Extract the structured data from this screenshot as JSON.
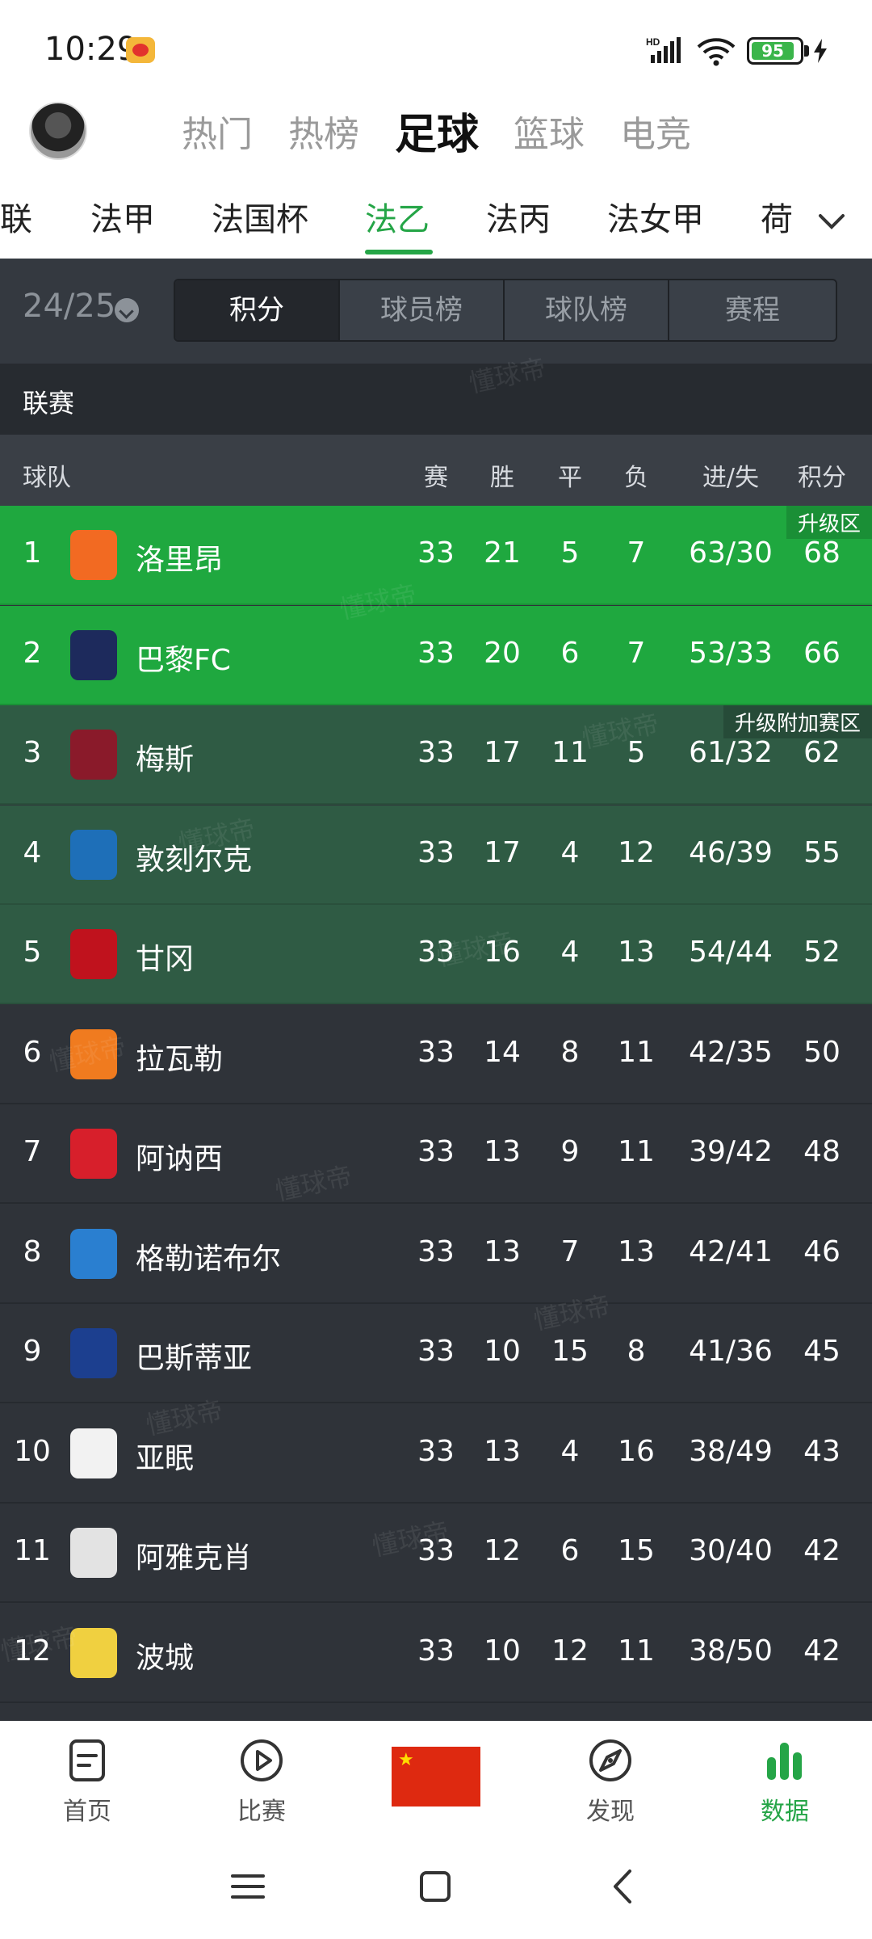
{
  "status_bar": {
    "time": "10:29",
    "battery": "95"
  },
  "top_tabs": [
    "热门",
    "热榜",
    "足球",
    "篮球",
    "电竞"
  ],
  "top_tab_active": 2,
  "league_tabs": [
    "联",
    "法甲",
    "法国杯",
    "法乙",
    "法丙",
    "法女甲",
    "荷"
  ],
  "league_tab_active": 3,
  "season": {
    "label": "24/25"
  },
  "segment_tabs": [
    "积分",
    "球员榜",
    "球队榜",
    "赛程"
  ],
  "segment_active": 0,
  "section_title": "联赛",
  "columns": {
    "team": "球队",
    "played": "赛",
    "won": "胜",
    "drawn": "平",
    "lost": "负",
    "goals": "进/失",
    "points": "积分"
  },
  "zones": {
    "promotion": "升级区",
    "playoff": "升级附加赛区"
  },
  "standings": [
    {
      "rank": "1",
      "team": "洛里昂",
      "played": "33",
      "won": "21",
      "drawn": "5",
      "lost": "7",
      "goals": "63/30",
      "points": "68",
      "zone": "promotion",
      "logo_color": "#f26a22"
    },
    {
      "rank": "2",
      "team": "巴黎FC",
      "played": "33",
      "won": "20",
      "drawn": "6",
      "lost": "7",
      "goals": "53/33",
      "points": "66",
      "zone": "promotion",
      "logo_color": "#1d2a5c"
    },
    {
      "rank": "3",
      "team": "梅斯",
      "played": "33",
      "won": "17",
      "drawn": "11",
      "lost": "5",
      "goals": "61/32",
      "points": "62",
      "zone": "playoff",
      "logo_color": "#8a1a2a"
    },
    {
      "rank": "4",
      "team": "敦刻尔克",
      "played": "33",
      "won": "17",
      "drawn": "4",
      "lost": "12",
      "goals": "46/39",
      "points": "55",
      "zone": "playoff",
      "logo_color": "#1e6fb8"
    },
    {
      "rank": "5",
      "team": "甘冈",
      "played": "33",
      "won": "16",
      "drawn": "4",
      "lost": "13",
      "goals": "54/44",
      "points": "52",
      "zone": "playoff",
      "logo_color": "#c0121d"
    },
    {
      "rank": "6",
      "team": "拉瓦勒",
      "played": "33",
      "won": "14",
      "drawn": "8",
      "lost": "11",
      "goals": "42/35",
      "points": "50",
      "zone": "normal",
      "logo_color": "#f07b1f"
    },
    {
      "rank": "7",
      "team": "阿讷西",
      "played": "33",
      "won": "13",
      "drawn": "9",
      "lost": "11",
      "goals": "39/42",
      "points": "48",
      "zone": "normal",
      "logo_color": "#d71f2b"
    },
    {
      "rank": "8",
      "team": "格勒诺布尔",
      "played": "33",
      "won": "13",
      "drawn": "7",
      "lost": "13",
      "goals": "42/41",
      "points": "46",
      "zone": "normal",
      "logo_color": "#2a7fd0"
    },
    {
      "rank": "9",
      "team": "巴斯蒂亚",
      "played": "33",
      "won": "10",
      "drawn": "15",
      "lost": "8",
      "goals": "41/36",
      "points": "45",
      "zone": "normal",
      "logo_color": "#1c3f8f"
    },
    {
      "rank": "10",
      "team": "亚眠",
      "played": "33",
      "won": "13",
      "drawn": "4",
      "lost": "16",
      "goals": "38/49",
      "points": "43",
      "zone": "normal",
      "logo_color": "#f2f2f2"
    },
    {
      "rank": "11",
      "team": "阿雅克肖",
      "played": "33",
      "won": "12",
      "drawn": "6",
      "lost": "15",
      "goals": "30/40",
      "points": "42",
      "zone": "normal",
      "logo_color": "#e3e3e3"
    },
    {
      "rank": "12",
      "team": "波城",
      "played": "33",
      "won": "10",
      "drawn": "12",
      "lost": "11",
      "goals": "38/50",
      "points": "42",
      "zone": "normal",
      "logo_color": "#f0d040"
    }
  ],
  "watermark_text": "懂球帝",
  "bottom_nav": [
    {
      "label": "首页",
      "icon": "home-doc-icon",
      "active": false
    },
    {
      "label": "比赛",
      "icon": "play-circle-icon",
      "active": false
    },
    {
      "label": "发现",
      "icon": "discover-icon",
      "active": false
    },
    {
      "label": "数据",
      "icon": "bar-chart-icon",
      "active": true
    }
  ],
  "colors": {
    "accent": "#25a547",
    "promotion": "#1fa83f",
    "playoff": "#2f5b44",
    "dark_bg": "#2f3339"
  }
}
